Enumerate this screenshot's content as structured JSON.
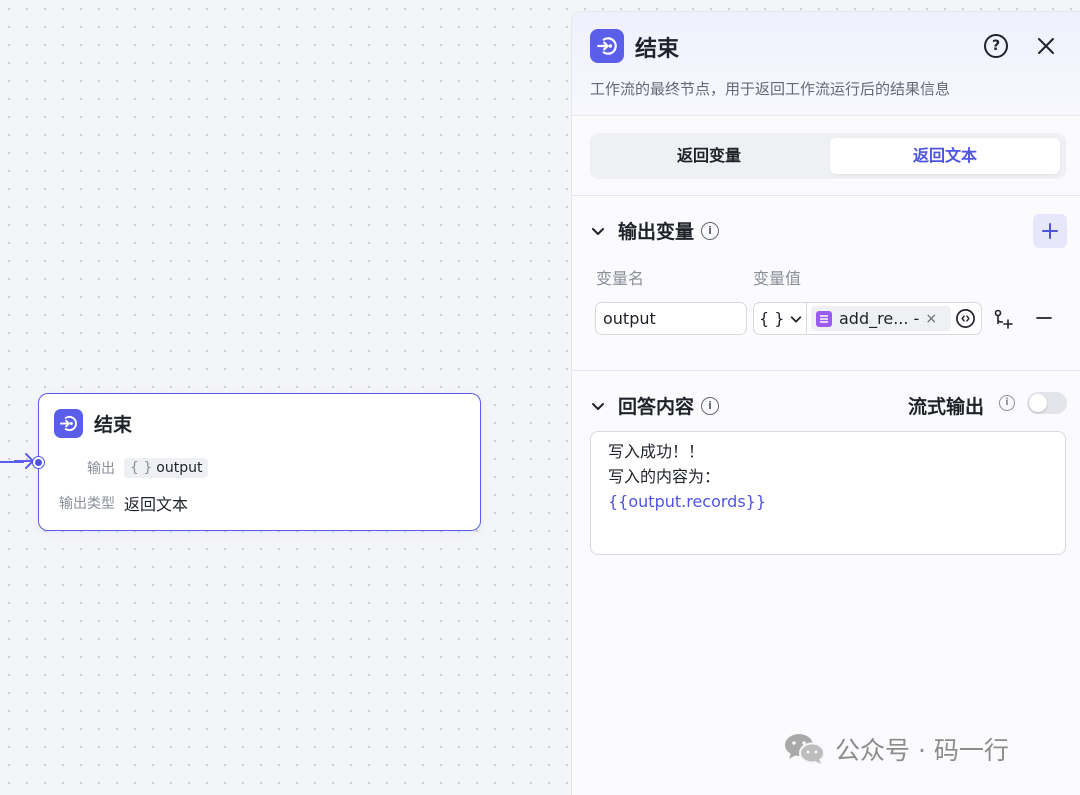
{
  "node": {
    "title": "结束",
    "output_label": "输出",
    "output_type_icon": "{ }",
    "output_value": "output",
    "type_label": "输出类型",
    "type_value": "返回文本"
  },
  "panel": {
    "title": "结束",
    "help_symbol": "?",
    "description": "工作流的最终节点，用于返回工作流运行后的结果信息",
    "tabs": [
      {
        "label": "返回变量",
        "active": false
      },
      {
        "label": "返回文本",
        "active": true
      }
    ],
    "output_section": {
      "title": "输出变量",
      "info_symbol": "i",
      "col_name": "变量名",
      "col_value": "变量值",
      "row": {
        "name": "output",
        "type_icon": "{ }",
        "var_ref": "add_re... -",
        "remove_symbol": "×"
      }
    },
    "answer_section": {
      "title": "回答内容",
      "info_symbol": "i",
      "stream_label": "流式输出",
      "stream_enabled": false,
      "lines": [
        "写入成功！！",
        "写入的内容为："
      ],
      "variable_line": "{{output.records}}"
    }
  },
  "watermark": {
    "text": "公众号 · 码一行",
    "icon": "wechat-icon"
  },
  "colors": {
    "accent": "#5a5ee8",
    "accent_text": "#4f54e0",
    "chip_icon": "#9a5cf0"
  }
}
